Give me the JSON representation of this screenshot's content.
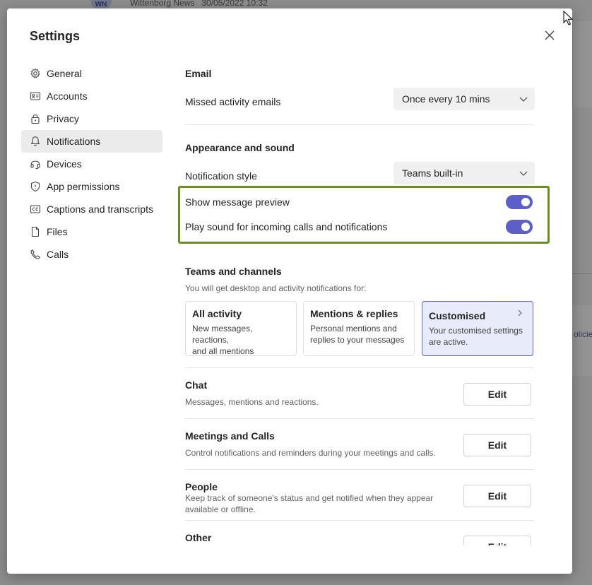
{
  "background": {
    "avatar_initials": "WN",
    "message_sender": "Wittenborg News",
    "message_timestamp": "30/05/2022 10:32",
    "side_link_text": "olicie"
  },
  "dialog": {
    "title": "Settings"
  },
  "nav": {
    "items": [
      {
        "label": "General",
        "icon": "gear-icon"
      },
      {
        "label": "Accounts",
        "icon": "id-card-icon"
      },
      {
        "label": "Privacy",
        "icon": "lock-icon"
      },
      {
        "label": "Notifications",
        "icon": "bell-icon",
        "active": true
      },
      {
        "label": "Devices",
        "icon": "headset-icon"
      },
      {
        "label": "App permissions",
        "icon": "shield-icon"
      },
      {
        "label": "Captions and transcripts",
        "icon": "cc-icon"
      },
      {
        "label": "Files",
        "icon": "file-icon"
      },
      {
        "label": "Calls",
        "icon": "phone-icon"
      }
    ]
  },
  "email": {
    "title": "Email",
    "missed_label": "Missed activity emails",
    "missed_value": "Once every 10 mins"
  },
  "appearance": {
    "title": "Appearance and sound",
    "style_label": "Notification style",
    "style_value": "Teams built-in",
    "preview_label": "Show message preview",
    "preview_on": true,
    "sound_label": "Play sound for incoming calls and notifications",
    "sound_on": true
  },
  "teams": {
    "title": "Teams and channels",
    "subtitle": "You will get desktop and activity notifications for:",
    "cards": [
      {
        "title": "All activity",
        "desc1": "New messages, reactions,",
        "desc2": "and all mentions"
      },
      {
        "title": "Mentions & replies",
        "desc1": "Personal mentions and",
        "desc2": "replies to your messages"
      },
      {
        "title": "Customised",
        "desc1": "Your customised settings",
        "desc2": "are active.",
        "selected": true
      }
    ]
  },
  "categories": [
    {
      "title": "Chat",
      "desc1": "Messages, mentions and reactions.",
      "desc2": "",
      "button": "Edit"
    },
    {
      "title": "Meetings and Calls",
      "desc1": "Control notifications and reminders during your meetings and calls.",
      "desc2": "",
      "button": "Edit"
    },
    {
      "title": "People",
      "desc1": "Keep track of someone's status and get notified when they appear",
      "desc2": "available or offline.",
      "button": "Edit"
    },
    {
      "title": "Other",
      "desc1": "",
      "desc2": "",
      "button": "Edit"
    }
  ],
  "colors": {
    "accent": "#5b5fc7",
    "highlight": "#6b8e23"
  }
}
